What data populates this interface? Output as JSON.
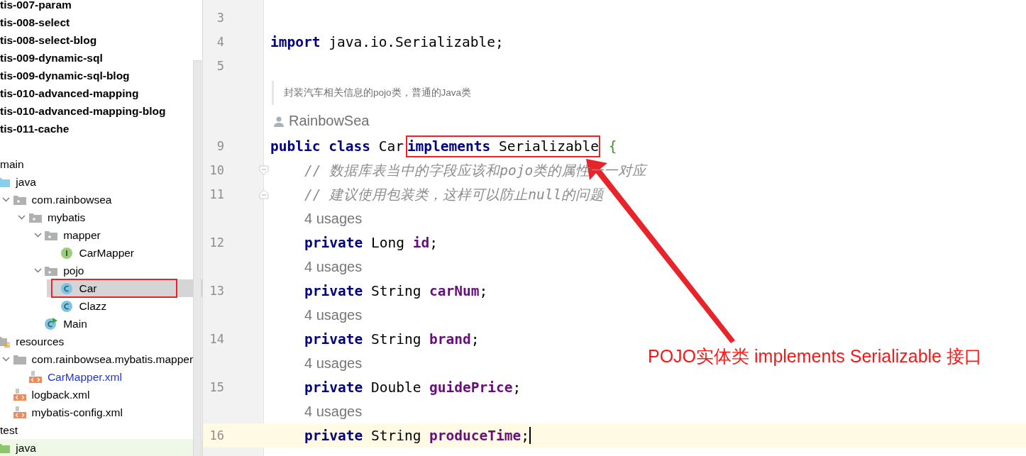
{
  "projects": [
    "tis-007-param",
    "tis-008-select",
    "tis-008-select-blog",
    "tis-009-dynamic-sql",
    "tis-009-dynamic-sql-blog",
    "tis-010-advanced-mapping",
    "tis-010-advanced-mapping-blog",
    "tis-011-cache"
  ],
  "tree": [
    {
      "label": "main",
      "selected": false,
      "modified": false,
      "children": [
        {
          "label": "java",
          "kind": "source",
          "selected": false,
          "modified": false,
          "children": [
            {
              "label": "com.rainbowsea",
              "kind": "package",
              "expanded": true,
              "selected": false,
              "modified": false,
              "children": [
                {
                  "label": "mybatis",
                  "kind": "package",
                  "expanded": true,
                  "selected": false,
                  "modified": false,
                  "children": [
                    {
                      "label": "mapper",
                      "kind": "package",
                      "expanded": true,
                      "selected": false,
                      "modified": false,
                      "children": [
                        {
                          "label": "CarMapper",
                          "kind": "interface",
                          "selected": false,
                          "modified": false
                        }
                      ]
                    },
                    {
                      "label": "pojo",
                      "kind": "package",
                      "expanded": true,
                      "selected": false,
                      "modified": false,
                      "children": [
                        {
                          "label": "Car",
                          "kind": "class",
                          "selected": true,
                          "modified": false,
                          "annotated": true
                        },
                        {
                          "label": "Clazz",
                          "kind": "class",
                          "selected": false,
                          "modified": false
                        }
                      ]
                    },
                    {
                      "label": "Main",
                      "kind": "main-class",
                      "selected": false,
                      "modified": false
                    }
                  ]
                }
              ]
            }
          ]
        },
        {
          "label": "resources",
          "kind": "resources",
          "selected": false,
          "modified": false,
          "children": [
            {
              "label": "com.rainbowsea.mybatis.mapper",
              "kind": "folder",
              "expanded": true,
              "selected": false,
              "modified": false,
              "children": [
                {
                  "label": "CarMapper.xml",
                  "kind": "xml",
                  "selected": false,
                  "modified": true
                }
              ]
            },
            {
              "label": "logback.xml",
              "kind": "xml",
              "selected": false,
              "modified": false
            },
            {
              "label": "mybatis-config.xml",
              "kind": "xml",
              "selected": false,
              "modified": false
            }
          ]
        }
      ]
    },
    {
      "label": "test",
      "selected": false,
      "modified": false,
      "children": [
        {
          "label": "java",
          "kind": "test-source",
          "selected": false,
          "modified": false
        }
      ]
    }
  ],
  "lines": [
    {
      "kind": "code",
      "number": "3",
      "current": false
    },
    {
      "kind": "code",
      "number": "4",
      "current": false,
      "indented": false,
      "tokens": [
        {
          "text": "import",
          "kind": "keyword"
        },
        {
          "text": " java.io.Serializable;",
          "kind": "plain"
        }
      ]
    },
    {
      "kind": "code",
      "number": "5",
      "current": false
    },
    {
      "kind": "doc",
      "text": "封装汽车相关信息的pojo类，普通的Java类"
    },
    {
      "kind": "author",
      "text": "RainbowSea"
    },
    {
      "kind": "code",
      "number": "9",
      "current": false,
      "indented": false,
      "tokens": [
        {
          "text": "public",
          "kind": "keyword"
        },
        {
          "text": " class",
          "kind": "keyword"
        },
        {
          "text": " Car",
          "kind": "plain"
        },
        {
          "box": [
            {
              "text": "implements",
              "kind": "keyword"
            },
            {
              "text": " Serializable",
              "kind": "plain"
            }
          ]
        },
        {
          "text": " {",
          "kind": "brace"
        }
      ]
    },
    {
      "kind": "code",
      "number": "10",
      "fold": {
        "kind": "start"
      },
      "current": false,
      "indented": true,
      "tokens": [
        {
          "text": "// 数据库表当中的字段应该和pojo类的属性一一对应",
          "kind": "comment"
        }
      ]
    },
    {
      "kind": "code",
      "number": "11",
      "fold": {
        "kind": "end"
      },
      "current": false,
      "indented": true,
      "tokens": [
        {
          "text": "// 建议使用包装类，这样可以防止null的问题",
          "kind": "comment"
        }
      ]
    },
    {
      "kind": "usages",
      "text": "4 usages"
    },
    {
      "kind": "code",
      "number": "12",
      "current": false,
      "indented": true,
      "tokens": [
        {
          "text": "private",
          "kind": "keyword"
        },
        {
          "text": " Long ",
          "kind": "plain"
        },
        {
          "text": "id",
          "kind": "field"
        },
        {
          "text": ";",
          "kind": "plain"
        }
      ]
    },
    {
      "kind": "usages",
      "text": "4 usages"
    },
    {
      "kind": "code",
      "number": "13",
      "current": false,
      "indented": true,
      "tokens": [
        {
          "text": "private",
          "kind": "keyword"
        },
        {
          "text": " String ",
          "kind": "plain"
        },
        {
          "text": "carNum",
          "kind": "field"
        },
        {
          "text": ";",
          "kind": "plain"
        }
      ]
    },
    {
      "kind": "usages",
      "text": "4 usages"
    },
    {
      "kind": "code",
      "number": "14",
      "current": false,
      "indented": true,
      "tokens": [
        {
          "text": "private",
          "kind": "keyword"
        },
        {
          "text": " String ",
          "kind": "plain"
        },
        {
          "text": "brand",
          "kind": "field"
        },
        {
          "text": ";",
          "kind": "plain"
        }
      ]
    },
    {
      "kind": "usages",
      "text": "4 usages"
    },
    {
      "kind": "code",
      "number": "15",
      "current": false,
      "indented": true,
      "tokens": [
        {
          "text": "private",
          "kind": "keyword"
        },
        {
          "text": " Double ",
          "kind": "plain"
        },
        {
          "text": "guidePrice",
          "kind": "field"
        },
        {
          "text": ";",
          "kind": "plain"
        }
      ]
    },
    {
      "kind": "usages",
      "text": "4 usages"
    },
    {
      "kind": "code",
      "number": "16",
      "current": true,
      "indented": true,
      "tokens": [
        {
          "text": "private",
          "kind": "keyword"
        },
        {
          "text": " String ",
          "kind": "plain"
        },
        {
          "text": "produceTime",
          "kind": "field"
        },
        {
          "text": ";",
          "kind": "plain"
        }
      ]
    }
  ],
  "annotation": {
    "text": "POJO实体类 implements Serializable 接口"
  }
}
